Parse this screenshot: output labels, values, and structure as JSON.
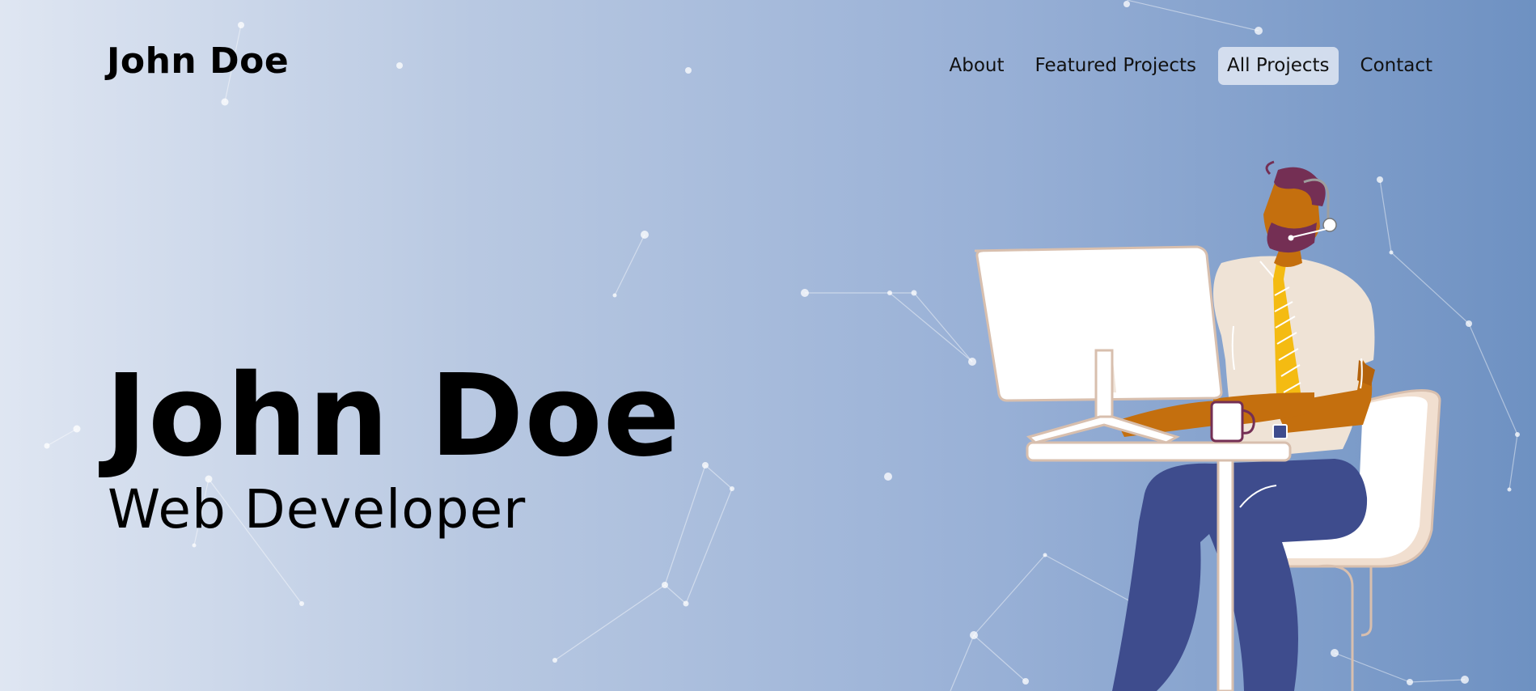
{
  "header": {
    "brand": "John Doe",
    "nav": [
      {
        "label": "About",
        "active": false
      },
      {
        "label": "Featured Projects",
        "active": false
      },
      {
        "label": "All Projects",
        "active": true
      },
      {
        "label": "Contact",
        "active": false
      }
    ]
  },
  "hero": {
    "title": "John Doe",
    "subtitle": "Web Developer",
    "illustration": "developer-at-desk-illustration"
  },
  "colors": {
    "background_start": "#dfe6f2",
    "background_end": "#6e91c2",
    "skin": "#c46f0e",
    "hair": "#742f54",
    "shirt": "#efe3d6",
    "tie": "#f4bb12",
    "pants": "#3e4c8d",
    "outline": "#d8bfae"
  }
}
